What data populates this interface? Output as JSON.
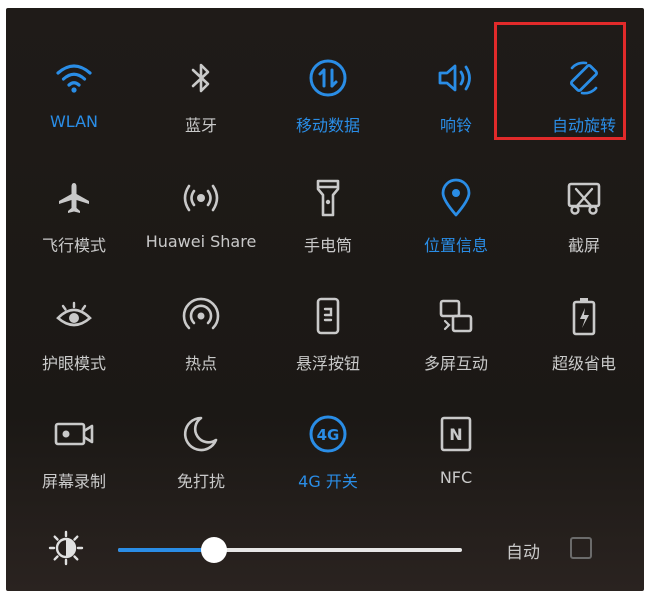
{
  "tiles": [
    {
      "label": "WLAN",
      "icon": "wifi-icon",
      "active": true
    },
    {
      "label": "蓝牙",
      "icon": "bluetooth-icon",
      "active": false
    },
    {
      "label": "移动数据",
      "icon": "mobile-data-icon",
      "active": true
    },
    {
      "label": "响铃",
      "icon": "speaker-icon",
      "active": true
    },
    {
      "label": "自动旋转",
      "icon": "auto-rotate-icon",
      "active": true
    },
    {
      "label": "飞行模式",
      "icon": "airplane-icon",
      "active": false
    },
    {
      "label": "Huawei Share",
      "icon": "huawei-share-icon",
      "active": false
    },
    {
      "label": "手电筒",
      "icon": "flashlight-icon",
      "active": false
    },
    {
      "label": "位置信息",
      "icon": "location-icon",
      "active": true
    },
    {
      "label": "截屏",
      "icon": "screenshot-icon",
      "active": false
    },
    {
      "label": "护眼模式",
      "icon": "eye-icon",
      "active": false
    },
    {
      "label": "热点",
      "icon": "hotspot-icon",
      "active": false
    },
    {
      "label": "悬浮按钮",
      "icon": "floating-button-icon",
      "active": false
    },
    {
      "label": "多屏互动",
      "icon": "multi-screen-icon",
      "active": false
    },
    {
      "label": "超级省电",
      "icon": "battery-saver-icon",
      "active": false
    },
    {
      "label": "屏幕录制",
      "icon": "screen-record-icon",
      "active": false
    },
    {
      "label": "免打扰",
      "icon": "moon-icon",
      "active": false
    },
    {
      "label": "4G 开关",
      "icon": "4g-icon",
      "active": true
    },
    {
      "label": "NFC",
      "icon": "nfc-icon",
      "active": false
    }
  ],
  "icon_glyph_4g": "4G",
  "icon_glyph_nfc": "N",
  "brightness": {
    "level": 0.28,
    "auto_label": "自动",
    "auto_checked": false
  },
  "colors": {
    "active": "#2a8de6",
    "inactive": "#c9c9c9",
    "highlight": "#e12a2a"
  }
}
